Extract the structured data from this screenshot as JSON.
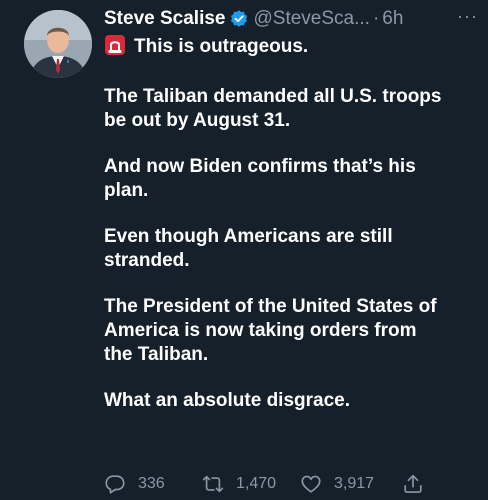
{
  "user": {
    "display_name": "Steve Scalise",
    "handle": "@SteveSca...",
    "separator": "·",
    "time": "6h",
    "avatar_icon": "profile-photo",
    "verified_icon": "verified-badge-icon"
  },
  "menu": {
    "more_label": "···"
  },
  "tweet": {
    "first_line": "This is outrageous.",
    "first_line_emoji": "police-siren-emoji",
    "paragraphs": [
      {
        "lines": [
          "The Taliban demanded all U.S. troops",
          "be out by August 31."
        ]
      },
      {
        "lines": [
          "And now Biden confirms that’s his",
          "plan."
        ]
      },
      {
        "lines": [
          "Even though Americans are still",
          "stranded."
        ]
      },
      {
        "lines": [
          "The President of the United States of",
          "America is now taking orders from",
          "the Taliban."
        ]
      },
      {
        "lines": [
          "What an absolute disgrace."
        ]
      }
    ]
  },
  "actions": {
    "replies": "336",
    "retweets": "1,470",
    "likes": "3,917",
    "reply_icon": "reply-icon",
    "retweet_icon": "retweet-icon",
    "like_icon": "heart-icon",
    "share_icon": "share-icon"
  },
  "colors": {
    "background": "#15202b",
    "primary_text": "#ffffff",
    "secondary_text": "#8b98a5",
    "verified": "#1d9bf0",
    "siren_red": "#e0263b"
  }
}
